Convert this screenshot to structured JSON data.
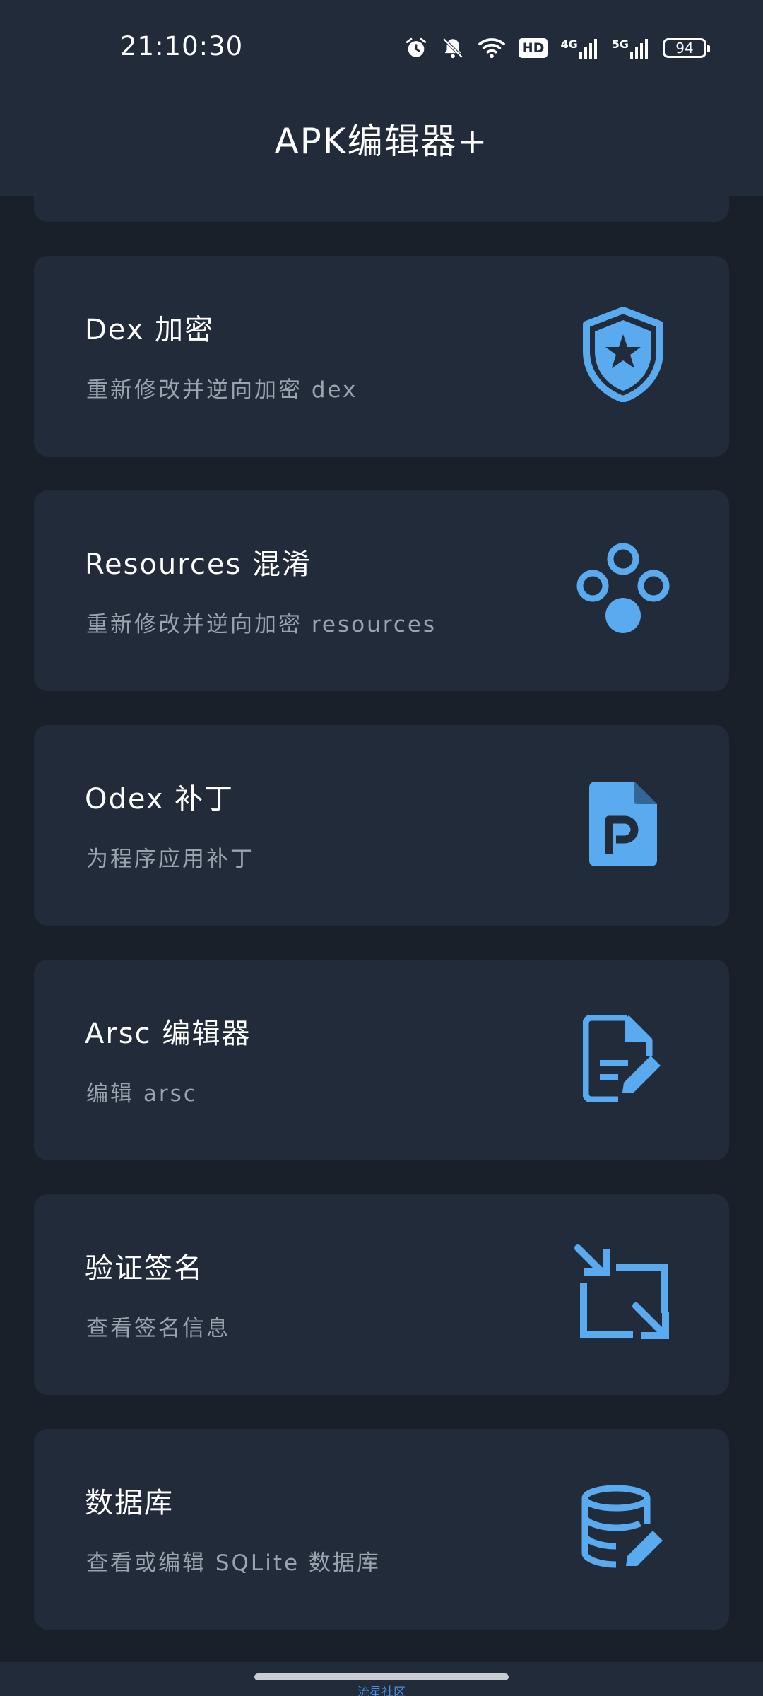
{
  "status_bar": {
    "time": "21:10:30",
    "battery": "94",
    "network_1": "4G",
    "network_2": "5G",
    "hd_badge": "HD"
  },
  "app_bar": {
    "title": "APK编辑器+"
  },
  "cards": [
    {
      "title": "Dex 加密",
      "subtitle": "重新修改并逆向加密 dex",
      "icon": "shield-star-icon"
    },
    {
      "title": "Resources 混淆",
      "subtitle": "重新修改并逆向加密 resources",
      "icon": "circles-icon"
    },
    {
      "title": "Odex 补丁",
      "subtitle": "为程序应用补丁",
      "icon": "patch-file-icon"
    },
    {
      "title": "Arsc 编辑器",
      "subtitle": "编辑 arsc",
      "icon": "edit-file-icon"
    },
    {
      "title": "验证签名",
      "subtitle": "查看签名信息",
      "icon": "arrows-resize-icon"
    },
    {
      "title": "数据库",
      "subtitle": "查看或编辑 SQLite 数据库",
      "icon": "database-edit-icon"
    }
  ],
  "footer": {
    "watermark": "流星社区"
  },
  "colors": {
    "accent": "#5aaaf0",
    "background": "#19202a",
    "card": "#212b39",
    "subtitle": "#9aa3ae"
  }
}
